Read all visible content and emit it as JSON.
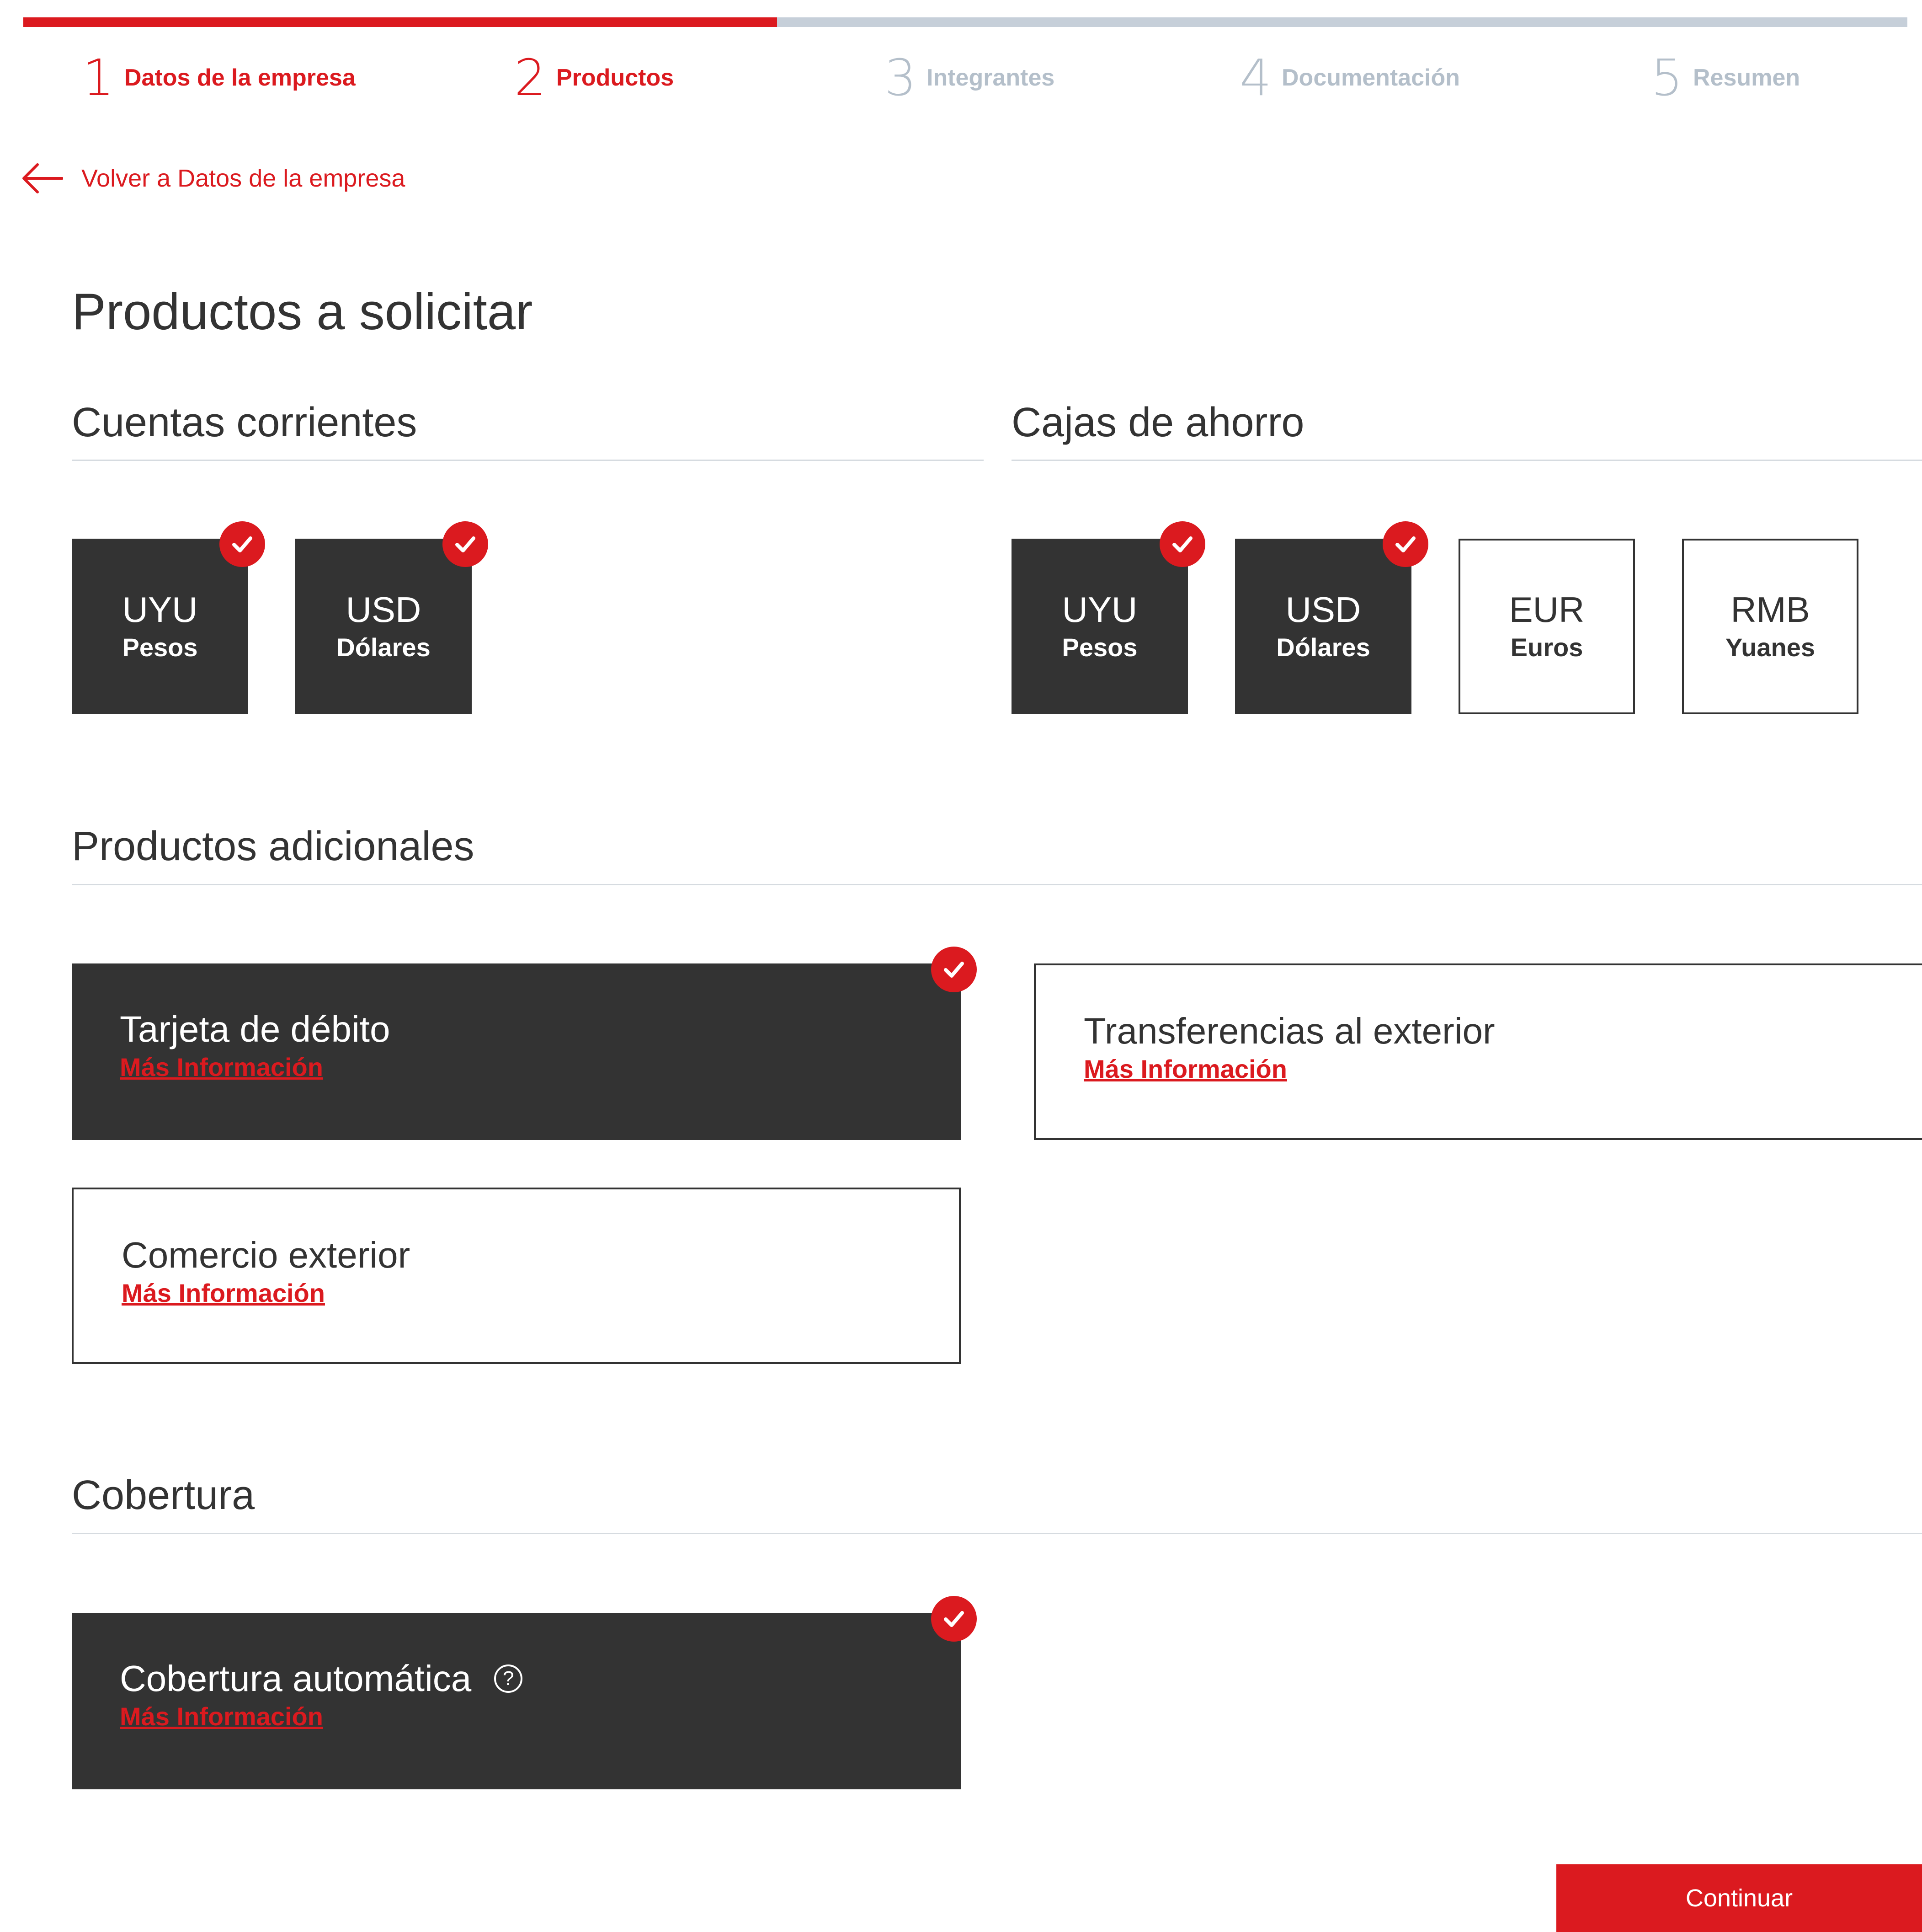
{
  "progress": {
    "percent": 40
  },
  "steps": [
    {
      "number": "1",
      "label": "Datos de la empresa",
      "state": "active"
    },
    {
      "number": "2",
      "label": "Productos",
      "state": "active"
    },
    {
      "number": "3",
      "label": "Integrantes",
      "state": "inactive"
    },
    {
      "number": "4",
      "label": "Documentación",
      "state": "inactive"
    },
    {
      "number": "5",
      "label": "Resumen",
      "state": "inactive"
    }
  ],
  "back_link": {
    "label": "Volver a Datos de la empresa",
    "icon": "arrow-left-icon"
  },
  "page_title": "Productos a solicitar",
  "cuentas_corrientes": {
    "title": "Cuentas corrientes",
    "tiles": [
      {
        "code": "UYU",
        "name": "Pesos",
        "selected": true
      },
      {
        "code": "USD",
        "name": "Dólares",
        "selected": true
      }
    ]
  },
  "cajas_de_ahorro": {
    "title": "Cajas de ahorro",
    "tiles": [
      {
        "code": "UYU",
        "name": "Pesos",
        "selected": true
      },
      {
        "code": "USD",
        "name": "Dólares",
        "selected": true
      },
      {
        "code": "EUR",
        "name": "Euros",
        "selected": false
      },
      {
        "code": "RMB",
        "name": "Yuanes",
        "selected": false
      }
    ]
  },
  "productos_adicionales": {
    "title": "Productos adicionales",
    "cards": [
      {
        "title": "Tarjeta de débito",
        "link": "Más Información",
        "selected": true
      },
      {
        "title": "Transferencias al exterior",
        "link": "Más Información",
        "selected": false
      },
      {
        "title": "Comercio exterior",
        "link": "Más Información",
        "selected": false
      }
    ]
  },
  "cobertura": {
    "title": "Cobertura",
    "cards": [
      {
        "title": "Cobertura automática",
        "link": "Más Información",
        "selected": true,
        "help_icon": "?"
      }
    ]
  },
  "continue_button": "Continuar",
  "colors": {
    "accent": "#db1a1f",
    "dark": "#333333",
    "inactive": "#b4bfca",
    "track": "#c6cfd9"
  }
}
